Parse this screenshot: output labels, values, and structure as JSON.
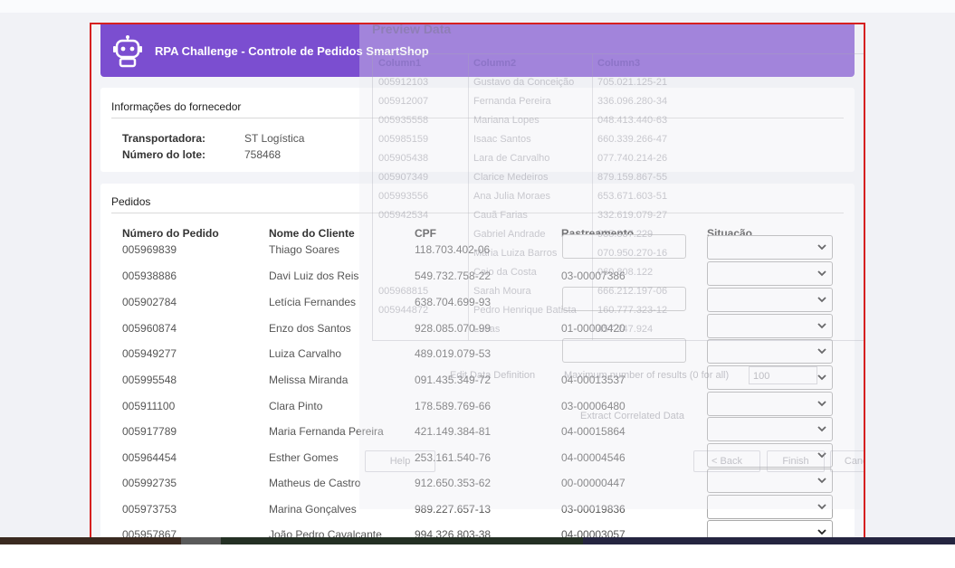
{
  "header": {
    "title": "RPA Challenge - Controle de Pedidos SmartShop"
  },
  "supplier": {
    "title": "Informações do fornecedor",
    "carrier_label": "Transportadora:",
    "carrier_value": "ST Logística",
    "batch_label": "Número do lote:",
    "batch_value": "758468"
  },
  "orders": {
    "title": "Pedidos",
    "columns": [
      "Número do Pedido",
      "Nome do Cliente",
      "CPF",
      "Rastreamento",
      "Situação"
    ],
    "rows": [
      {
        "order": "005969839",
        "client": "Thiago Soares",
        "cpf": "118.703.402-06",
        "tracking": "",
        "tracking_input": true
      },
      {
        "order": "005938886",
        "client": "Davi Luiz dos Reis",
        "cpf": "549.732.758-22",
        "tracking": "03-00007386",
        "tracking_input": false
      },
      {
        "order": "005902784",
        "client": "Letícia Fernandes",
        "cpf": "638.704.699-93",
        "tracking": "",
        "tracking_input": true
      },
      {
        "order": "005960874",
        "client": "Enzo dos Santos",
        "cpf": "928.085.070-99",
        "tracking": "01-00000420",
        "tracking_input": false
      },
      {
        "order": "005949277",
        "client": "Luiza Carvalho",
        "cpf": "489.019.079-53",
        "tracking": "",
        "tracking_input": true
      },
      {
        "order": "005995548",
        "client": "Melissa Miranda",
        "cpf": "091.435.349-72",
        "tracking": "04-00013537",
        "tracking_input": false
      },
      {
        "order": "005911100",
        "client": "Clara Pinto",
        "cpf": "178.589.769-66",
        "tracking": "03-00006480",
        "tracking_input": false
      },
      {
        "order": "005917789",
        "client": "Maria Fernanda Pereira",
        "cpf": "421.149.384-81",
        "tracking": "04-00015864",
        "tracking_input": false
      },
      {
        "order": "005964454",
        "client": "Esther Gomes",
        "cpf": "253.161.540-76",
        "tracking": "04-00004546",
        "tracking_input": false
      },
      {
        "order": "005992735",
        "client": "Matheus de Castro",
        "cpf": "912.650.353-62",
        "tracking": "00-00000447",
        "tracking_input": false
      },
      {
        "order": "005973753",
        "client": "Marina Gonçalves",
        "cpf": "989.227.657-13",
        "tracking": "03-00019836",
        "tracking_input": false
      },
      {
        "order": "005957867",
        "client": "João Pedro Cavalcante",
        "cpf": "994.326.803-38",
        "tracking": "04-00003057",
        "tracking_input": false
      }
    ]
  },
  "overlay": {
    "title": "Preview Data",
    "columns": [
      "Column1",
      "Column2",
      "Column3"
    ],
    "rows": [
      [
        "005912103",
        "Gustavo da Conceição",
        "705.021.125-21"
      ],
      [
        "005912007",
        "Fernanda Pereira",
        "336.096.280-34"
      ],
      [
        "005935558",
        "Mariana Lopes",
        "048.413.440-63"
      ],
      [
        "005985159",
        "Isaac Santos",
        "660.339.266-47"
      ],
      [
        "005905438",
        "Lara de Carvalho",
        "077.740.214-26"
      ],
      [
        "005907349",
        "Clarice Medeiros",
        "879.159.867-55"
      ],
      [
        "005993556",
        "Ana Julia Moraes",
        "653.671.603-51"
      ],
      [
        "005942534",
        "Cauã Farias",
        "332.619.079-27"
      ],
      [
        "",
        "Gabriel Andrade",
        "935.837.229"
      ],
      [
        "",
        "Maria Luiza Barros",
        "070.950.270-16"
      ],
      [
        "",
        "Caio da Costa",
        "060.808.122"
      ],
      [
        "005968815",
        "Sarah Moura",
        "666.212.197-06"
      ],
      [
        "005944872",
        "Pedro Henrique Batista",
        "160.777.323-12"
      ],
      [
        "",
        "Lucas",
        "457.247.924"
      ]
    ],
    "edit_label": "Edit Data Definition",
    "max_label": "Maximum number of results (0 for all)",
    "max_value": "100",
    "extract_label": "Extract Correlated Data",
    "help_label": "Help",
    "back_label": "< Back",
    "finish_label": "Finish",
    "cancel_label": "Cancel"
  },
  "colors": {
    "header": "#7b4ed0",
    "frame_border": "#d62020"
  }
}
